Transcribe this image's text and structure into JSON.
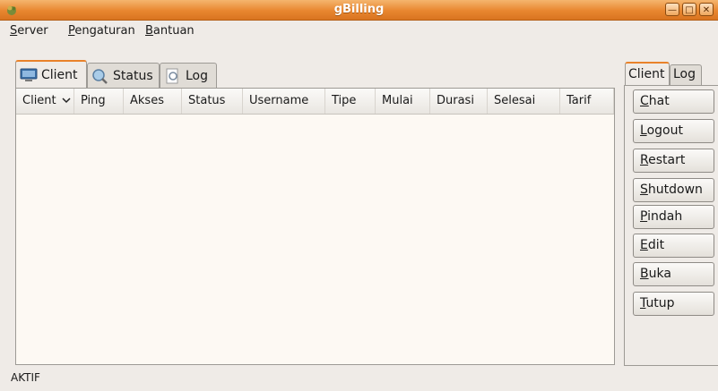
{
  "window": {
    "title": "gBilling",
    "icon": "app-icon",
    "controls": [
      "minimize-icon",
      "maximize-icon",
      "close-icon"
    ]
  },
  "menu": [
    {
      "label": "Server",
      "mnemonic": "S"
    },
    {
      "label": "Pengaturan",
      "mnemonic": "P"
    },
    {
      "label": "Bantuan",
      "mnemonic": "B"
    }
  ],
  "tabs": [
    {
      "label": "Client",
      "icon": "monitor-icon",
      "active": true
    },
    {
      "label": "Status",
      "icon": "magnifier-icon",
      "active": false
    },
    {
      "label": "Log",
      "icon": "document-icon",
      "active": false
    }
  ],
  "table": {
    "columns": [
      "Client",
      "Ping",
      "Akses",
      "Status",
      "Username",
      "Tipe",
      "Mulai",
      "Durasi",
      "Selesai",
      "Tarif"
    ],
    "sort_column": "Client",
    "rows": []
  },
  "right_panel": {
    "tabs": [
      {
        "label": "Client",
        "active": true
      },
      {
        "label": "Log",
        "active": false
      }
    ],
    "buttons": [
      {
        "label": "Chat",
        "mnemonic": "C"
      },
      {
        "label": "Logout",
        "mnemonic": "L"
      },
      {
        "label": "Restart",
        "mnemonic": "R"
      },
      {
        "label": "Shutdown",
        "mnemonic": "S"
      },
      {
        "label": "Pindah",
        "mnemonic": "P"
      },
      {
        "label": "Edit",
        "mnemonic": "E"
      },
      {
        "label": "Buka",
        "mnemonic": "B"
      },
      {
        "label": "Tutup",
        "mnemonic": "T"
      }
    ]
  },
  "status_bar": {
    "text": "AKTIF"
  },
  "colors": {
    "titlebar": "#e8862f",
    "table_bg": "#fdf9f3",
    "window_bg": "#efebe7",
    "active_tab_accent": "#e9822a"
  }
}
